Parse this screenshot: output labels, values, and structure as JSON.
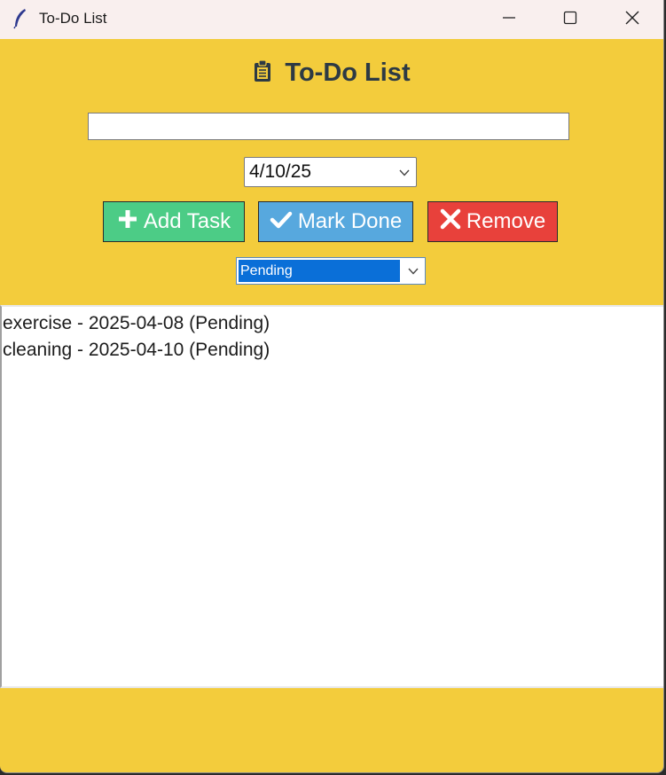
{
  "window": {
    "title": "To-Do List",
    "icon": "feather-icon",
    "controls": [
      "minimize-icon",
      "maximize-icon",
      "close-icon"
    ]
  },
  "header": {
    "title": "To-Do List",
    "icon": "clipboard-icon"
  },
  "task_input": {
    "value": "",
    "placeholder": ""
  },
  "date_picker": {
    "value": "4/10/25"
  },
  "buttons": {
    "add": {
      "label": "Add Task",
      "icon": "plus-icon",
      "color": "#4ccc86"
    },
    "done": {
      "label": "Mark Done",
      "icon": "checkmark-icon",
      "color": "#57a8de"
    },
    "remove": {
      "label": "Remove",
      "icon": "x-icon",
      "color": "#e8413b"
    }
  },
  "filter": {
    "value": "Pending"
  },
  "tasks": [
    {
      "text": "exercise - 2025-04-08 (Pending)"
    },
    {
      "text": "cleaning - 2025-04-10 (Pending)"
    }
  ],
  "colors": {
    "background": "#f3cc3c",
    "titlebar": "#f9efee",
    "selection": "#0a6fd8"
  }
}
